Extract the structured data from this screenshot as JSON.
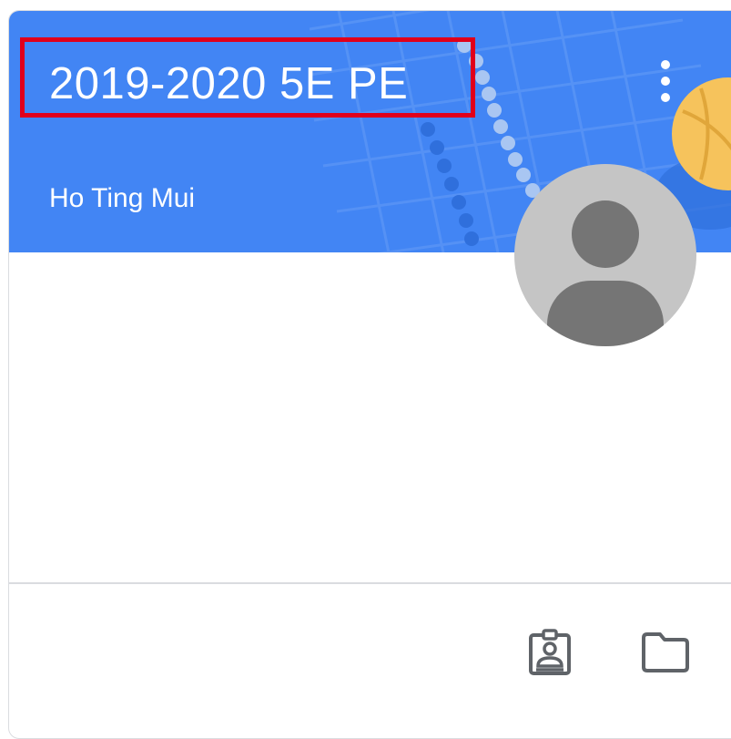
{
  "class_card": {
    "title": "2019-2020 5E PE",
    "teacher": "Ho Ting Mui"
  },
  "icons": {
    "more": "more-vert-icon",
    "avatar": "account-circle-icon",
    "work": "assignment-ind-icon",
    "folder": "folder-icon"
  },
  "colors": {
    "banner": "#4285f4",
    "highlight": "#e0001b",
    "avatar_bg": "#c5c5c5",
    "avatar_fg": "#757575",
    "icon": "#5f6368",
    "ball": "#f6c35c"
  }
}
